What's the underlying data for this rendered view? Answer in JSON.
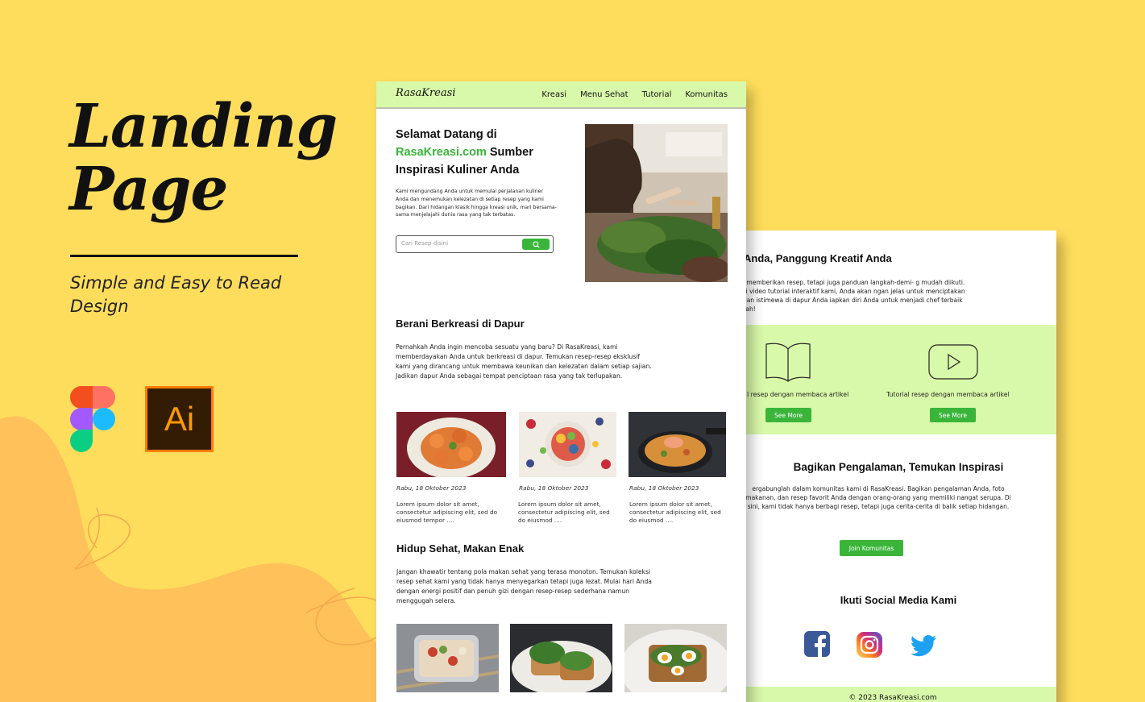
{
  "promo": {
    "title_line1": "Landing",
    "title_line2": "Page",
    "subtitle": "Simple and Easy to Read Design"
  },
  "colors": {
    "background": "#ffdd5c",
    "accent_green": "#3ab53a",
    "light_green": "#d8f9a9"
  },
  "tool_icons": [
    "figma-logo",
    "adobe-illustrator-logo"
  ],
  "front": {
    "logo": "RasaKreasi",
    "nav": [
      "Kreasi",
      "Menu Sehat",
      "Tutorial",
      "Komunitas"
    ],
    "hero": {
      "title_pre": "Selamat Datang di",
      "title_accent": "RasaKreasi.com",
      "title_post": "Sumber Inspirasi Kuliner Anda",
      "text": "Kami mengundang Anda untuk memulai perjalanan kuliner Anda dan menemukan kelezatan di setiap resep yang kami bagikan. Dari hidangan klasik hingga kreasi unik, mari bersama-sama menjelajahi dunia rasa yang tak terbatas.",
      "search_placeholder": "Cari Resep disini"
    },
    "section1": {
      "title": "Berani Berkreasi di Dapur",
      "text": "Pernahkah Anda ingin mencoba sesuatu yang baru? Di RasaKreasi, kami memberdayakan Anda untuk berkreasi di dapur. Temukan resep-resep eksklusif kami yang dirancang untuk membawa keunikan dan kelezatan dalam setiap sajian. Jadikan dapur Anda sebagai tempat penciptaan rasa yang tak terlupakan."
    },
    "cards": [
      {
        "date": "Rabu, 18 Oktober 2023",
        "text": "Lorem ipsum dolor sit amet, consectetur adipiscing elit, sed do eiusmod tempor ...."
      },
      {
        "date": "Rabu, 18 Oktober 2023",
        "text": "Lorem ipsum dolor sit amet, consectetur adipiscing elit, sed do eiusmod ...."
      },
      {
        "date": "Rabu, 18 Oktober 2023",
        "text": "Lorem ipsum dolor sit amet, consectetur adipiscing elit, sed do eiusmod ...."
      }
    ],
    "section2": {
      "title": "Hidup Sehat, Makan Enak",
      "text": "Jangan khawatir tentang pola makan sehat yang terasa monoton. Temukan koleksi resep sehat kami yang tidak hanya menyegarkan tetapi juga lezat. Mulai hari Anda dengan energi positif dan penuh gizi dengan resep-resep sederhana namun menggugah selera."
    }
  },
  "back": {
    "title": "Anda, Panggung Kreatif Anda",
    "text": "hanya memberikan resep, tetapi juga panduan langkah-demi- g mudah diikuti. Melalui video tutorial interaktif kami, Anda akan ngan jelas untuk menciptakan hidangan istimewa di dapur Anda iapkan diri Anda untuk menjadi chef terbaik di rumah!",
    "features": [
      {
        "caption": "l resep dengan membaca artikel",
        "button": "See More"
      },
      {
        "caption": "Tutorial resep dengan membaca artikel",
        "button": "See More"
      }
    ],
    "community": {
      "title": "Bagikan Pengalaman, Temukan Inspirasi",
      "text": "ergabunglah dalam komunitas kami di RasaKreasi. Bagikan pengalaman Anda, foto makanan, dan resep favorit Anda dengan orang-orang yang memiliki nangat serupa. Di sini, kami tidak hanya berbagi resep, tetapi juga cerita-cerita di balik setiap hidangan.",
      "button": "Join Komunitas"
    },
    "social": {
      "title": "Ikuti Social Media Kami",
      "icons": [
        "facebook-icon",
        "instagram-icon",
        "twitter-icon"
      ]
    },
    "footer": "© 2023 RasaKreasi.com"
  }
}
